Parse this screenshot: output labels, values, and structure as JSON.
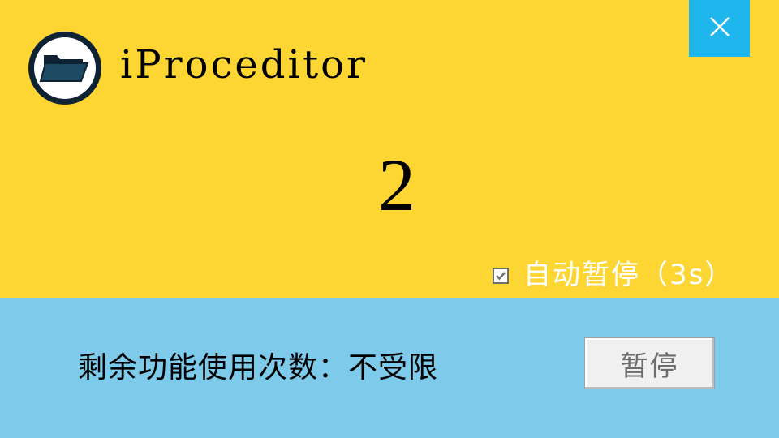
{
  "app": {
    "title": "iProceditor",
    "logo_icon": "folder-open-icon"
  },
  "window_controls": {
    "close_icon": "close-icon"
  },
  "countdown": {
    "value": "2"
  },
  "auto_pause": {
    "label": "自动暂停（3s）",
    "checked": true
  },
  "usage": {
    "text": "剩余功能使用次数：不受限"
  },
  "pause_button": {
    "label": "暂停"
  },
  "colors": {
    "top_background": "#FDD633",
    "bottom_background": "#7ECAEA",
    "close_button": "#1EB6EC",
    "logo_ring": "#0E2233",
    "logo_folder": "#1C4A63"
  }
}
